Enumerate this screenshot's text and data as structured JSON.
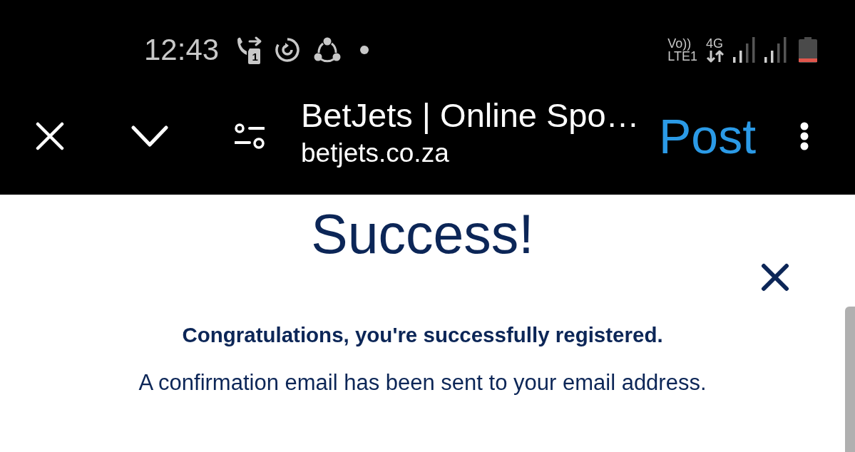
{
  "status_bar": {
    "time": "12:43",
    "sim_slot": "1",
    "volte": {
      "top": "Vo))",
      "bottom": "LTE1"
    },
    "network": "4G"
  },
  "browser_toolbar": {
    "page_title": "BetJets | Online Spo…",
    "url": "betjets.co.za",
    "action": "Post"
  },
  "dialog": {
    "title": "Success!",
    "heading": "Congratulations, you're successfully registered.",
    "message": "A confirmation email has been sent to your email address."
  }
}
